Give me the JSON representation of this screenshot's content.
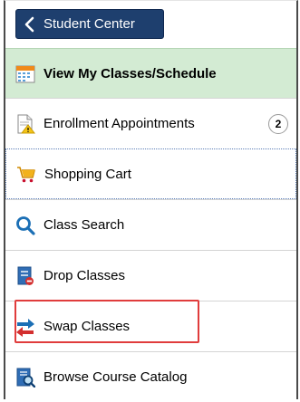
{
  "back_button": {
    "label": "Student Center",
    "icon": "chevron-left-icon"
  },
  "menu": {
    "items": [
      {
        "label": "View My Classes/Schedule",
        "icon": "calendar-icon"
      },
      {
        "label": "Enrollment Appointments",
        "icon": "document-warning-icon",
        "badge": "2"
      },
      {
        "label": "Shopping Cart",
        "icon": "shopping-cart-icon"
      },
      {
        "label": "Class Search",
        "icon": "search-icon"
      },
      {
        "label": "Drop Classes",
        "icon": "drop-document-icon"
      },
      {
        "label": "Swap Classes",
        "icon": "swap-arrows-icon"
      },
      {
        "label": "Browse Course Catalog",
        "icon": "catalog-search-icon"
      }
    ]
  },
  "colors": {
    "back_button_bg": "#1e3f6e",
    "active_item_bg": "#d3ebd3",
    "highlight_border": "#e03c3c"
  }
}
